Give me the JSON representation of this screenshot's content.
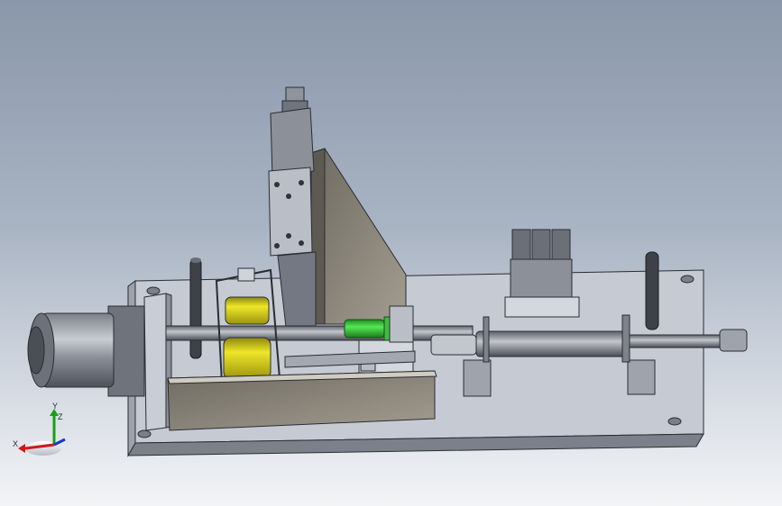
{
  "triad": {
    "x_label": "X",
    "y_label": "Y",
    "z_label": "Z",
    "colors": {
      "x": "#d01818",
      "y": "#18a018",
      "z": "#1838c8"
    }
  },
  "palette": {
    "metal_light": "#c7ccd6",
    "metal_mid": "#9aa0ab",
    "metal_dark": "#5e636c",
    "brass_yellow": "#e6de1e",
    "green_part": "#38d438",
    "bronze": "#8b867c"
  }
}
